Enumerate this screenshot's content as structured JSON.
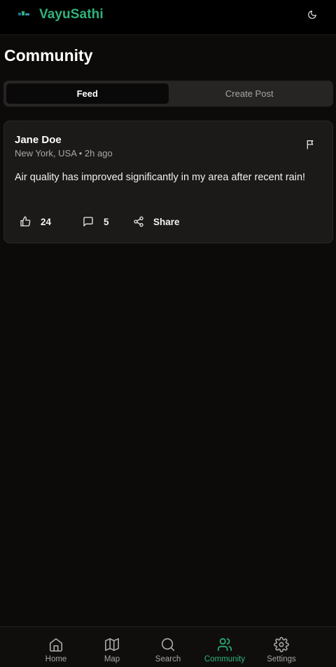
{
  "header": {
    "app_title": "VayuSathi",
    "logo_icon": "vayusathi-logo-icon",
    "theme_icon": "moon-icon"
  },
  "page": {
    "title": "Community"
  },
  "tabs": [
    {
      "label": "Feed",
      "active": true
    },
    {
      "label": "Create Post",
      "active": false
    }
  ],
  "posts": [
    {
      "author": "Jane Doe",
      "location": "New York, USA",
      "time": "2h ago",
      "meta": "New York, USA • 2h ago",
      "text": "Air quality has improved significantly in my area after recent rain!",
      "likes": "24",
      "comments": "5",
      "share_label": "Share"
    }
  ],
  "bottom_nav": [
    {
      "label": "Home",
      "icon": "home-icon",
      "active": false
    },
    {
      "label": "Map",
      "icon": "map-icon",
      "active": false
    },
    {
      "label": "Search",
      "icon": "search-icon",
      "active": false
    },
    {
      "label": "Community",
      "icon": "users-icon",
      "active": true
    },
    {
      "label": "Settings",
      "icon": "gear-icon",
      "active": false
    }
  ],
  "colors": {
    "accent": "#2fb37a",
    "background": "#0c0b0a",
    "card": "#1c1a18",
    "muted_text": "#a9a6a2"
  }
}
